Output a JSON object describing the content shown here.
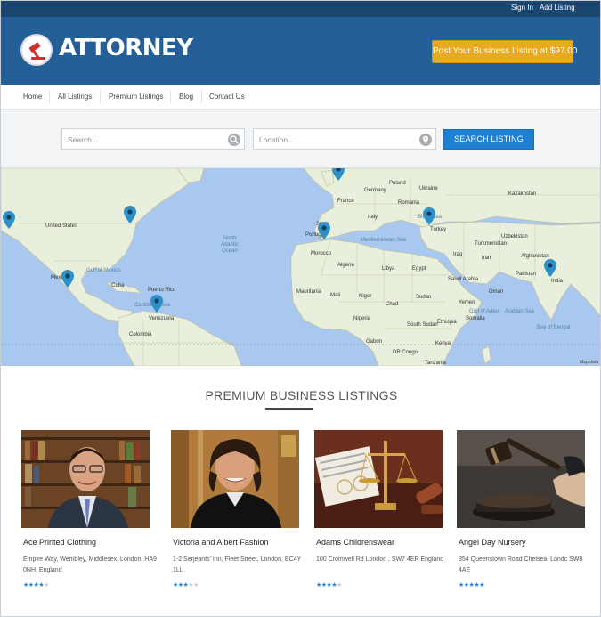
{
  "topbar": {
    "signin": "Sign In",
    "add_listing": "Add Listing"
  },
  "header": {
    "logo_text": "ATTORNEY",
    "post_button": "Post Your Business Listing at $97.00"
  },
  "nav": {
    "items": [
      "Home",
      "All Listings",
      "Premium Listings",
      "Blog",
      "Contact Us"
    ]
  },
  "search": {
    "keyword_placeholder": "Search...",
    "location_placeholder": "Location...",
    "button": "SEARCH LISTING"
  },
  "map": {
    "labels": [
      "United States",
      "Mexico",
      "Cuba",
      "Puerto Rico",
      "Caribbean Sea",
      "Venezuela",
      "Colombia",
      "Gulf of Mexico",
      "North Atlantic Ocean",
      "Morocco",
      "Algeria",
      "Libya",
      "Egypt",
      "Mali",
      "Niger",
      "Chad",
      "Sudan",
      "Mauritania",
      "Nigeria",
      "Ethiopia",
      "South Sudan",
      "Kenya",
      "Tanzania",
      "DR Congo",
      "Gabon",
      "Saudi Arabia",
      "Oman",
      "Yemen",
      "Somalia",
      "Iran",
      "Iraq",
      "Turkey",
      "Spain",
      "Portugal",
      "France",
      "Germany",
      "Poland",
      "Ukraine",
      "Romania",
      "Italy",
      "Kazakhstan",
      "Uzbekistan",
      "Turkmenistan",
      "Afghanistan",
      "Pakistan",
      "India",
      "Arabian Sea",
      "Bay of Bengal",
      "Black Sea",
      "Mediterranean Sea",
      "Gulf of Aden"
    ],
    "credit": "Map data"
  },
  "section_title": "PREMIUM BUSINESS LISTINGS",
  "listings": [
    {
      "name": "Ace Printed Clothing",
      "address": "Empire Way, Wembley, Middlesex, London, HA9 0NH, England",
      "rating": 4
    },
    {
      "name": "Victoria and Albert Fashion",
      "address": "1-2 Serjeants' Inn, Fleet Street, London, EC4Y 1LL",
      "rating": 3
    },
    {
      "name": "Adams Childrenswear",
      "address": "100 Cromwell Rd London , SW7 4ER England",
      "rating": 4
    },
    {
      "name": "Angel Day Nursery",
      "address": "354 Queenstown Road Chelsea, Londc SW8 4AE",
      "rating": 5
    }
  ],
  "colors": {
    "header_blue": "#245f98",
    "topbar_navy": "#1b4670",
    "accent_orange": "#e9a920",
    "button_blue": "#1f7fd1",
    "map_water": "#a8c8f0",
    "map_land": "#e8efdc",
    "star_blue": "#2d7fd2"
  }
}
